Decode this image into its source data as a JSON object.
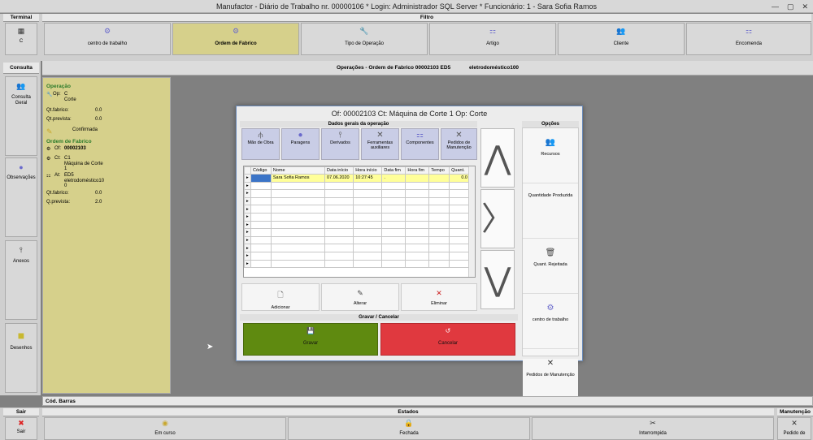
{
  "window": {
    "title": "Manufactor - Diário de Trabalho nr. 00000106 * Login: Administrador SQL Server * Funcionário: 1 - Sara Sofia Ramos",
    "btn_min": "—",
    "btn_max": "▢",
    "btn_close": "✕"
  },
  "terminal": {
    "header": "Terminal",
    "button_label": "C"
  },
  "filtro": {
    "header": "Filtro",
    "buttons": [
      {
        "label": "centro de trabalho"
      },
      {
        "label": "Ordem de Fabrico"
      },
      {
        "label": "Tipo de Operação"
      },
      {
        "label": "Artigo"
      },
      {
        "label": "Cliente"
      },
      {
        "label": "Encomenda"
      }
    ]
  },
  "consulta": {
    "header": "Consulta",
    "buttons": [
      {
        "label": "Consulta Geral"
      },
      {
        "label": "Observações"
      },
      {
        "label": "Anexos"
      },
      {
        "label": "Desenhos"
      }
    ]
  },
  "operations_header": {
    "left": "Operações - Ordem de Fabrico 00002103 ED5",
    "right": "eletrodoméstico100"
  },
  "info_panel": {
    "op_section": "Operação",
    "op_label": "Op:",
    "op_code": "C",
    "op_name": "Corte",
    "qt_fabrico_label": "Qt.fabrico:",
    "qt_fabrico_value": "0.0",
    "qt_prevista_label": "Qt.prevista:",
    "qt_prevista_value": "0.0",
    "status": "Confirmada",
    "of_section": "Ordem de Fabrico",
    "of_label": "Of:",
    "of_value": "00002103",
    "ct_label": "Ct:",
    "ct_code": "C1",
    "ct_name": "Máquina de Corte",
    "ct_num": "1",
    "at_label": "At:",
    "at_code": "ED5",
    "at_name": "eletrodoméstico10",
    "at_num": "0",
    "qt_fabrico2_label": "Qt.fabrico:",
    "qt_fabrico2_value": "0.0",
    "qt_prevista2_label": "Q.prevista:",
    "qt_prevista2_value": "2.0"
  },
  "dialog": {
    "title": "Of: 00002103   Ct: Máquina de Corte 1   Op: Corte",
    "general_header": "Dados gerais da operação",
    "tool_buttons": [
      {
        "label": "Mão de Obra"
      },
      {
        "label": "Paragens"
      },
      {
        "label": "Derivados"
      },
      {
        "label": "Ferramentas auxiliares"
      },
      {
        "label": "Componentes"
      },
      {
        "label": "Pedidos de Manutenção"
      }
    ],
    "columns": [
      "Código",
      "Nome",
      "Data início",
      "Hora início",
      "Data fim",
      "Hora fim",
      "Tempo",
      "Quant."
    ],
    "row": {
      "codigo": "",
      "nome": "Sara Sofia Ramos",
      "data_inicio": "07.06.2020",
      "hora_inicio": "10:27:45",
      "data_fim": ".",
      "hora_fim": "",
      "tempo": "",
      "quant": "0.0"
    },
    "actions": [
      {
        "label": "Adicionar"
      },
      {
        "label": "Alterar"
      },
      {
        "label": "Eliminar"
      }
    ],
    "save_header": "Gravar / Cancelar",
    "save_label": "Gravar",
    "cancel_label": "Cancelar",
    "options_header": "Opções",
    "options": [
      {
        "label": "Recursos"
      },
      {
        "label": "Quantidade Produzida"
      },
      {
        "label": "Quant. Rejeitada"
      },
      {
        "label": "centro de trabalho"
      },
      {
        "label": "Pedidos de Manutenção"
      }
    ]
  },
  "cod_barras": "Cód. Barras",
  "sair": {
    "header": "Sair",
    "label": "Sair"
  },
  "estados": {
    "header": "Estados",
    "buttons": [
      {
        "label": "Em curso"
      },
      {
        "label": "Fechada"
      },
      {
        "label": "Interrompida"
      }
    ]
  },
  "manutencao": {
    "header": "Manutenção",
    "label": "Pedido de"
  },
  "colors": {
    "accent_panel": "#d6d08b",
    "save": "#5f8a10",
    "cancel": "#e0393f",
    "row_highlight": "#ffff99"
  }
}
